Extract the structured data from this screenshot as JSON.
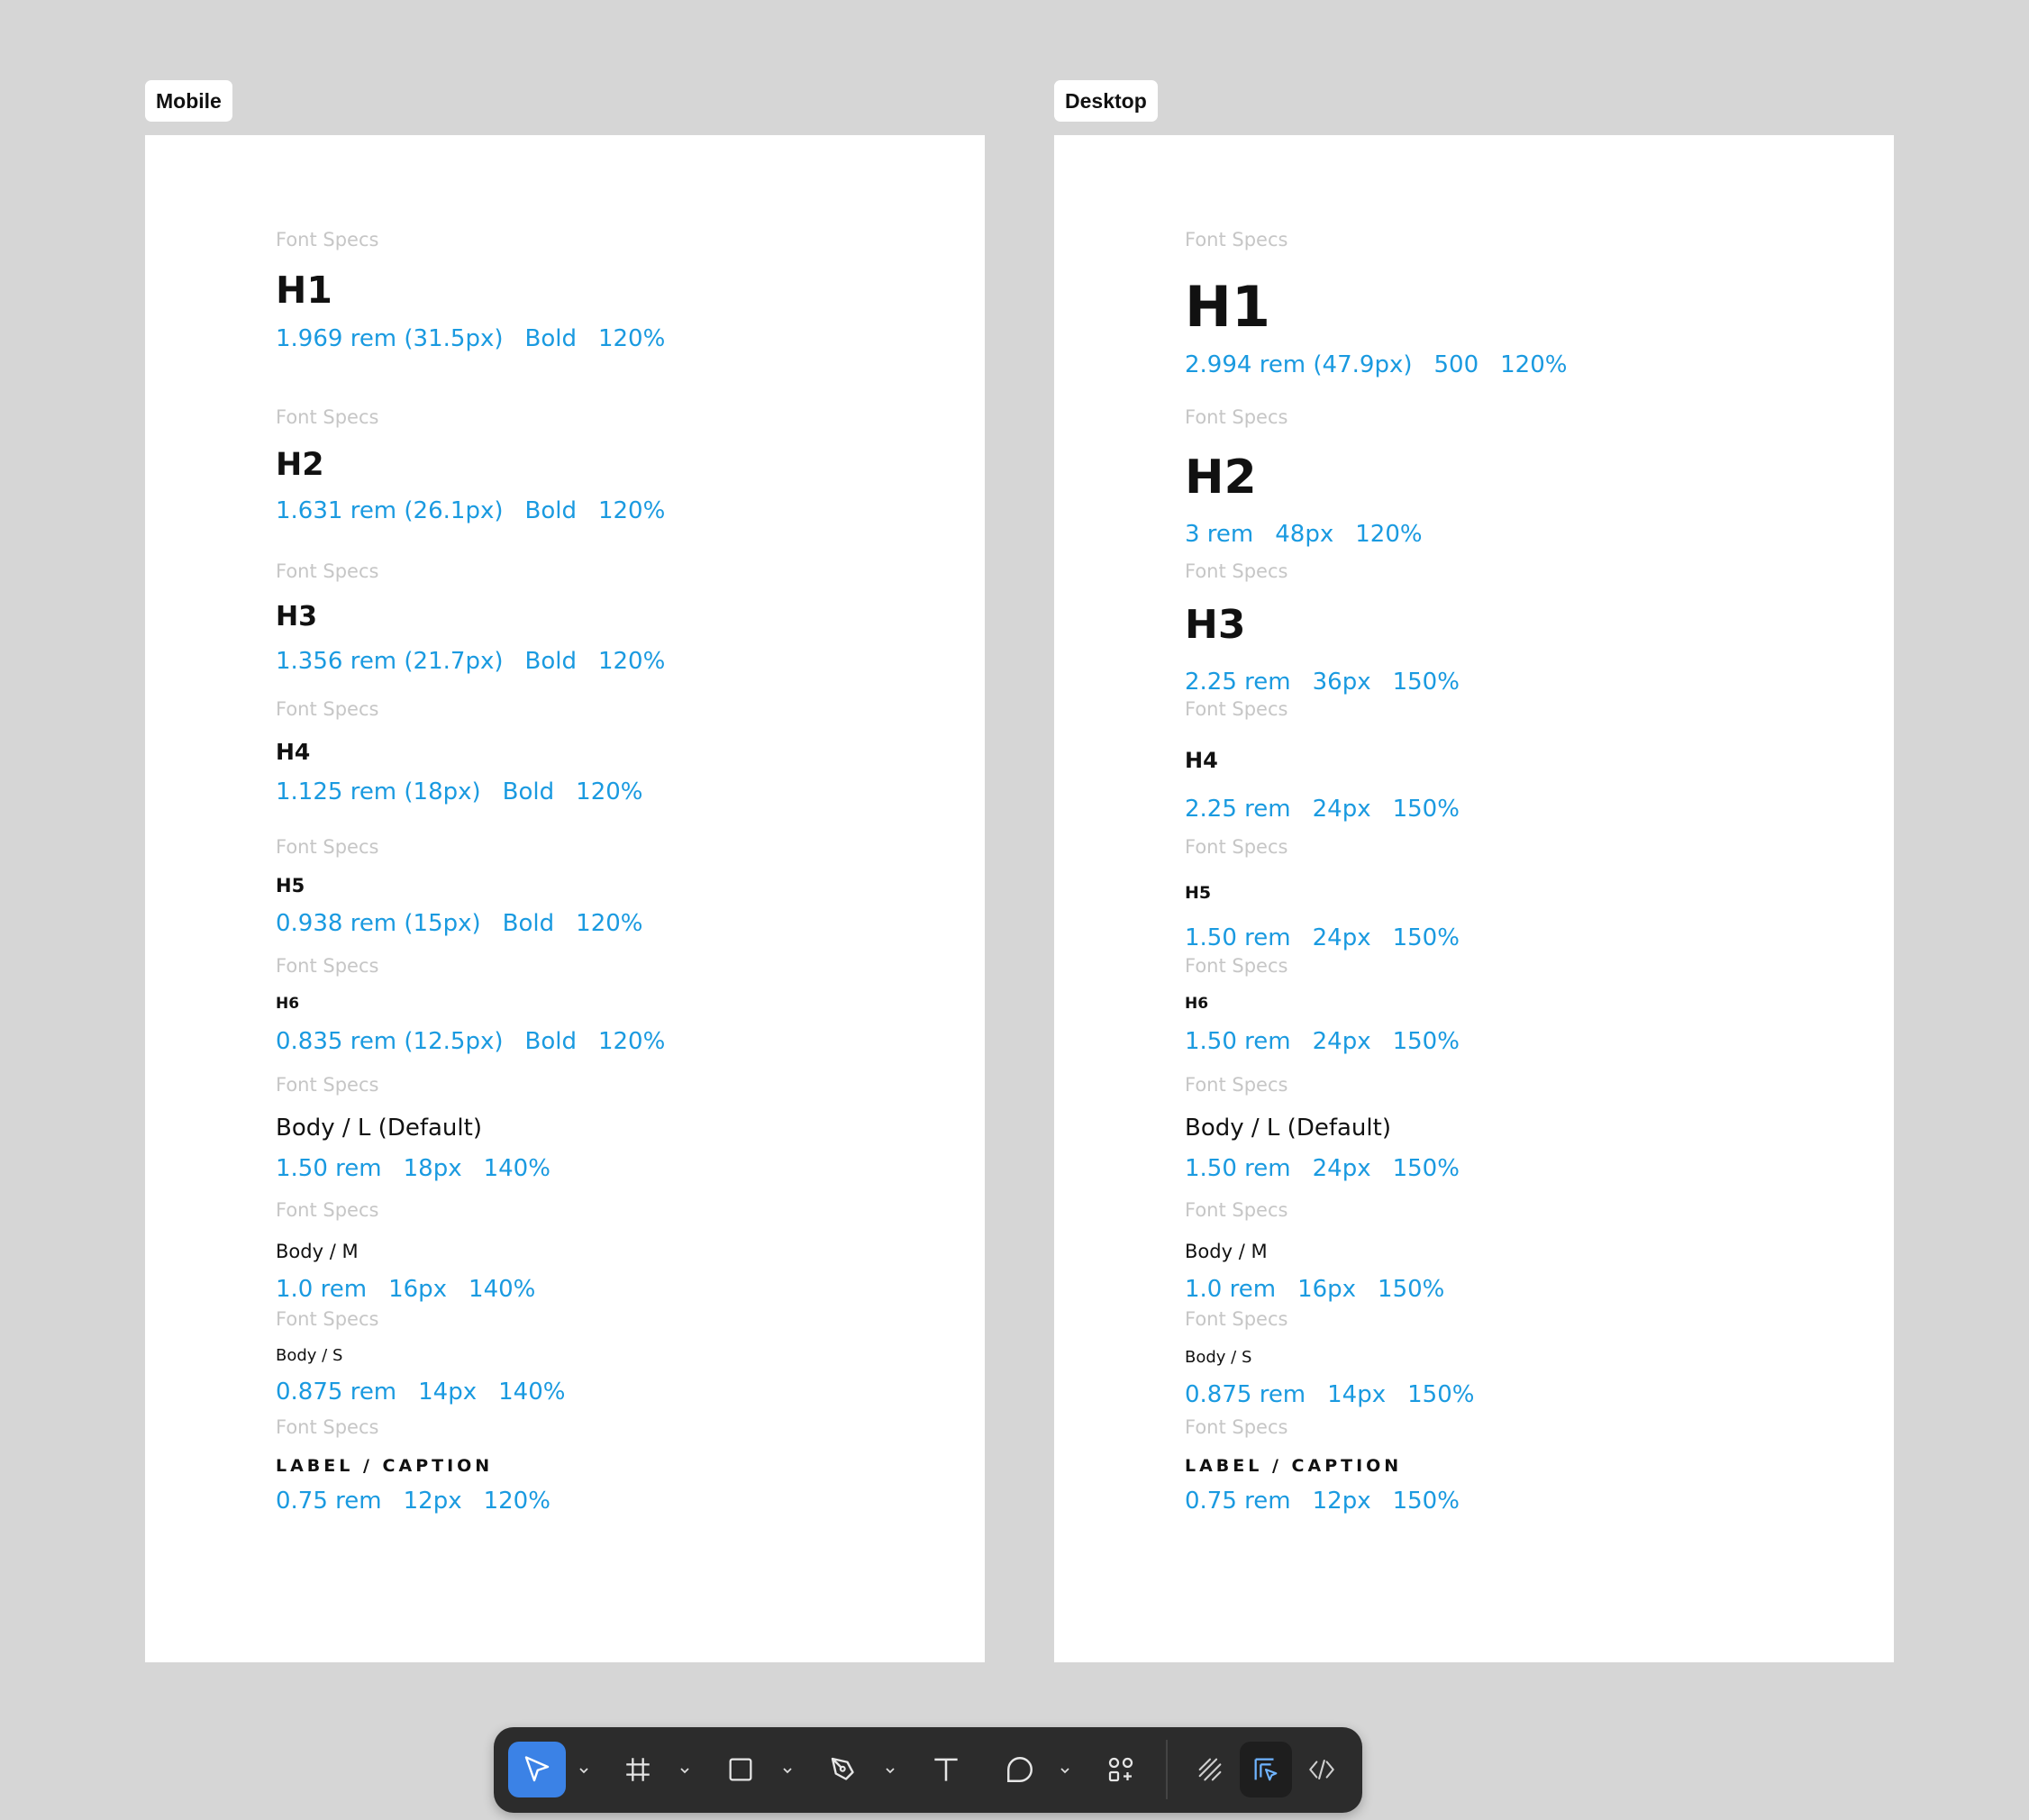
{
  "frames": [
    {
      "label": "Mobile",
      "styles": [
        {
          "caption": "Font Specs",
          "name": "H1",
          "specs": [
            "1.969 rem (31.5px)",
            "Bold",
            "120%"
          ]
        },
        {
          "caption": "Font Specs",
          "name": "H2",
          "specs": [
            "1.631 rem (26.1px)",
            "Bold",
            "120%"
          ]
        },
        {
          "caption": "Font Specs",
          "name": "H3",
          "specs": [
            "1.356 rem (21.7px)",
            "Bold",
            "120%"
          ]
        },
        {
          "caption": "Font Specs",
          "name": "H4",
          "specs": [
            "1.125 rem (18px)",
            "Bold",
            "120%"
          ]
        },
        {
          "caption": "Font Specs",
          "name": "H5",
          "specs": [
            "0.938 rem (15px)",
            "Bold",
            "120%"
          ]
        },
        {
          "caption": "Font Specs",
          "name": "H6",
          "specs": [
            "0.835 rem (12.5px)",
            "Bold",
            "120%"
          ]
        },
        {
          "caption": "Font Specs",
          "name": "Body / L (Default)",
          "specs": [
            "1.50 rem",
            "18px",
            "140%"
          ]
        },
        {
          "caption": "Font Specs",
          "name": "Body / M",
          "specs": [
            "1.0 rem",
            "16px",
            "140%"
          ]
        },
        {
          "caption": "Font Specs",
          "name": "Body / S",
          "specs": [
            "0.875 rem",
            "14px",
            "140%"
          ]
        },
        {
          "caption": "Font Specs",
          "name": "LABEL / CAPTION",
          "specs": [
            "0.75 rem",
            "12px",
            "120%"
          ]
        }
      ]
    },
    {
      "label": "Desktop",
      "styles": [
        {
          "caption": "Font Specs",
          "name": "H1",
          "specs": [
            "2.994 rem (47.9px)",
            "500",
            "120%"
          ]
        },
        {
          "caption": "Font Specs",
          "name": "H2",
          "specs": [
            "3 rem",
            "48px",
            "120%"
          ]
        },
        {
          "caption": "Font Specs",
          "name": "H3",
          "specs": [
            "2.25 rem",
            "36px",
            "150%"
          ]
        },
        {
          "caption": "Font Specs",
          "name": "H4",
          "specs": [
            "2.25 rem",
            "24px",
            "150%"
          ]
        },
        {
          "caption": "Font Specs",
          "name": "H5",
          "specs": [
            "1.50 rem",
            "24px",
            "150%"
          ]
        },
        {
          "caption": "Font Specs",
          "name": "H6",
          "specs": [
            "1.50 rem",
            "24px",
            "150%"
          ]
        },
        {
          "caption": "Font Specs",
          "name": "Body / L (Default)",
          "specs": [
            "1.50 rem",
            "24px",
            "150%"
          ]
        },
        {
          "caption": "Font Specs",
          "name": "Body / M",
          "specs": [
            "1.0 rem",
            "16px",
            "150%"
          ]
        },
        {
          "caption": "Font Specs",
          "name": "Body / S",
          "specs": [
            "0.875 rem",
            "14px",
            "150%"
          ]
        },
        {
          "caption": "Font Specs",
          "name": "LABEL / CAPTION",
          "specs": [
            "0.75 rem",
            "12px",
            "150%"
          ]
        }
      ]
    }
  ],
  "toolbar": {
    "tools": [
      {
        "name": "move-tool",
        "icon": "cursor-arrow-icon",
        "active": true
      },
      {
        "name": "frame-tool",
        "icon": "hash-frame-icon"
      },
      {
        "name": "shape-tool",
        "icon": "square-icon"
      },
      {
        "name": "pen-tool",
        "icon": "pen-nib-icon"
      },
      {
        "name": "text-tool",
        "icon": "text-t-icon"
      },
      {
        "name": "comment-tool",
        "icon": "speech-bubble-icon"
      },
      {
        "name": "actions-tool",
        "icon": "components-grid-icon"
      },
      {
        "name": "draw-mode",
        "icon": "scribble-icon"
      },
      {
        "name": "design-mode",
        "icon": "design-mode-icon",
        "selected": true
      },
      {
        "name": "dev-mode",
        "icon": "code-brackets-icon"
      }
    ],
    "colors": {
      "bg": "#2c2c2c",
      "active": "#3b82e6",
      "spec_text": "#1a9ae0"
    }
  }
}
